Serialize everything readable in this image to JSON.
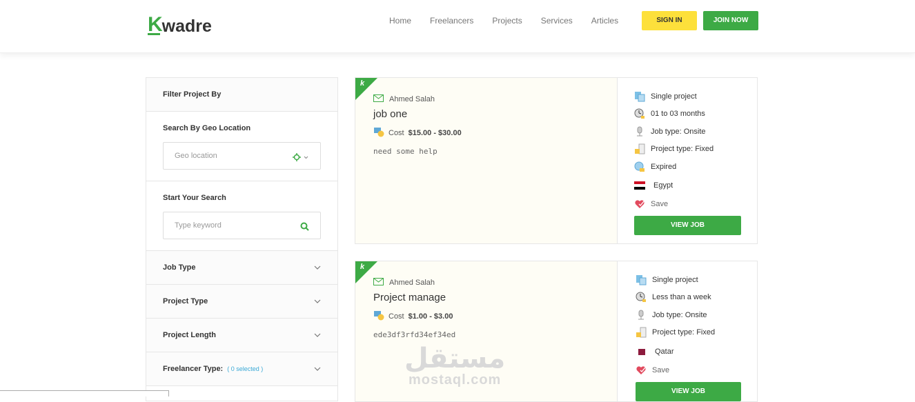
{
  "brand": {
    "logo_k": "K",
    "logo_rest": "wadre"
  },
  "nav": {
    "items": [
      "Home",
      "Freelancers",
      "Projects",
      "Services",
      "Articles"
    ]
  },
  "auth": {
    "signin": "SIGN IN",
    "join": "JOIN NOW"
  },
  "colors": {
    "primary": "#3daa45",
    "signin": "#fde03b",
    "card_bg": "#fefdf5",
    "selected": "#3aa9d6"
  },
  "sidebar": {
    "title": "Filter Project By",
    "geo_label": "Search By Geo Location",
    "geo_placeholder": "Geo location",
    "search_label": "Start Your Search",
    "search_placeholder": "Type keyword",
    "filters": [
      {
        "label": "Job Type",
        "extra": ""
      },
      {
        "label": "Project Type",
        "extra": ""
      },
      {
        "label": "Project Length",
        "extra": ""
      },
      {
        "label": "Freelancer Type:",
        "extra": "( 0 selected )"
      }
    ]
  },
  "jobs": [
    {
      "author": "Ahmed Salah",
      "title": "job one",
      "cost_label": "Cost",
      "cost": "$15.00 - $30.00",
      "desc": "need some help",
      "details": [
        "Single project",
        "01 to 03 months",
        "Job type: Onsite",
        "Project type: Fixed",
        "Expired",
        "Egypt",
        "Save"
      ],
      "button": "VIEW JOB"
    },
    {
      "author": "Ahmed Salah",
      "title": "Project manage",
      "cost_label": "Cost",
      "cost": "$1.00 - $3.00",
      "desc": "ede3df3rfd34ef34ed",
      "details": [
        "Single project",
        "Less than a week",
        "Job type: Onsite",
        "Project type: Fixed",
        "Qatar",
        "Save"
      ],
      "button": "VIEW JOB"
    }
  ],
  "watermark": {
    "arabic": "مستقل",
    "latin": "mostaql.com"
  }
}
